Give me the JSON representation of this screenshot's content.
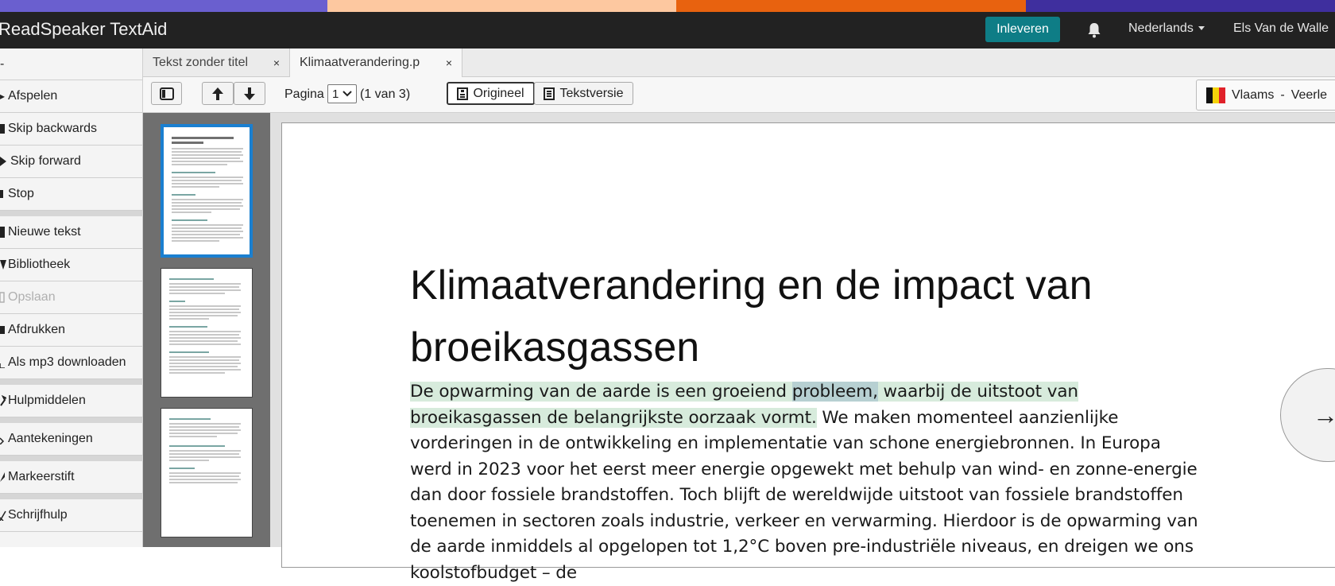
{
  "colors": {
    "stripe": [
      "#6a5fcf",
      "#fdc8a0",
      "#e8620f",
      "#3f2f9e"
    ],
    "topbar": "#222222",
    "submit": "#0e7d86",
    "highlight_sentence": "#d7ebdc",
    "highlight_word": "#b7d0d2",
    "thumb_active": "#1a7fd0"
  },
  "header": {
    "app_title": "ReadSpeaker TextAid",
    "submit_label": "Inleveren",
    "bell_icon": "bell-icon",
    "language": "Nederlands",
    "user": "Els Van de Walle"
  },
  "sidebar": {
    "collapse_label": "-",
    "items": [
      {
        "label": "Afspelen",
        "icon": "play-icon"
      },
      {
        "label": "Skip backwards",
        "icon": "skip-back-icon"
      },
      {
        "label": "Skip forward",
        "icon": "skip-forward-icon"
      },
      {
        "label": "Stop",
        "icon": "stop-icon"
      },
      {
        "label": "Nieuwe tekst",
        "icon": "new-document-icon"
      },
      {
        "label": "Bibliotheek",
        "icon": "library-icon"
      },
      {
        "label": "Opslaan",
        "icon": "save-icon"
      },
      {
        "label": "Afdrukken",
        "icon": "print-icon"
      },
      {
        "label": "Als mp3 downloaden",
        "icon": "download-icon"
      },
      {
        "label": "Hulpmiddelen",
        "icon": "tools-icon"
      },
      {
        "label": "Aantekeningen",
        "icon": "notes-icon"
      },
      {
        "label": "Markeerstift",
        "icon": "highlighter-icon"
      },
      {
        "label": "Schrijfhulp",
        "icon": "writing-help-icon"
      }
    ]
  },
  "tabs": [
    {
      "label": "Tekst zonder titel",
      "close": "×"
    },
    {
      "label": "Klimaatverandering.p",
      "close": "×"
    }
  ],
  "toolbar": {
    "page_label": "Pagina",
    "page_value": "1",
    "page_count": "(1 van 3)",
    "view_original": "Origineel",
    "view_text": "Tekstversie",
    "voice_language": "Vlaams",
    "voice_separator": "-",
    "voice_name": "Veerle"
  },
  "document": {
    "title_line1": "Klimaatverandering en de impact van",
    "title_line2": "broeikasgassen",
    "sentence_before_word": "De opwarming van de aarde is een groeiend ",
    "highlighted_word": "probleem,",
    "sentence_after_word": " waarbij de uitstoot van broeikasgassen de belangrijkste oorzaak vormt.",
    "body_rest": " We maken momenteel aanzienlijke vorderingen in de ontwikkeling en implementatie van schone energiebronnen. In Europa werd in 2023 voor het eerst meer energie opgewekt met behulp van wind- en zonne-energie dan door fossiele brandstoffen. Toch blijft de wereldwijde uitstoot van fossiele brandstoffen toenemen in sectoren zoals industrie, verkeer en verwarming. Hierdoor is de opwarming van de aarde inmiddels al opgelopen tot 1,2°C boven pre-industriële niveaus, en dreigen we ons koolstofbudget – de",
    "next_arrow": "→"
  }
}
